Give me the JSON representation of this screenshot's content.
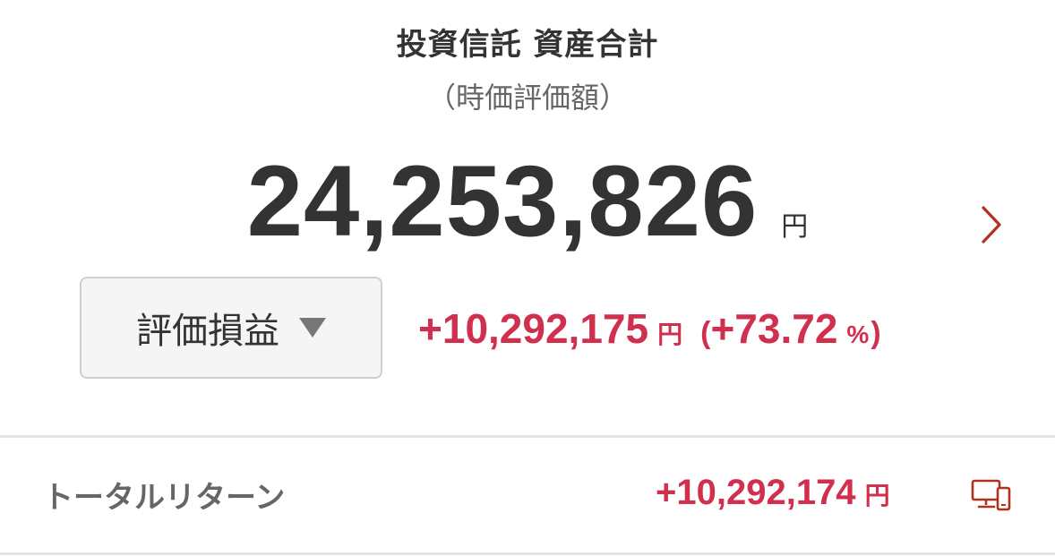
{
  "header": {
    "title": "投資信託 資産合計",
    "subtitle": "（時価評価額）"
  },
  "total": {
    "value": "24,253,826",
    "unit": "円"
  },
  "detail_link": {
    "icon": "chevron-right-icon"
  },
  "gain_selector": {
    "label": "評価損益",
    "icon": "triangle-down-icon"
  },
  "gain": {
    "amount": "+10,292,175",
    "unit": "円",
    "paren_open": "(",
    "percent": "+73.72",
    "percent_unit": "%",
    "paren_close": ")"
  },
  "total_return": {
    "label": "トータルリターン",
    "amount": "+10,292,174",
    "unit": "円",
    "icon": "pc-device-icon"
  },
  "colors": {
    "accent_red": "#d0304e",
    "text_dark": "#333333",
    "text_gray": "#666666",
    "icon_red": "#b0321e"
  }
}
